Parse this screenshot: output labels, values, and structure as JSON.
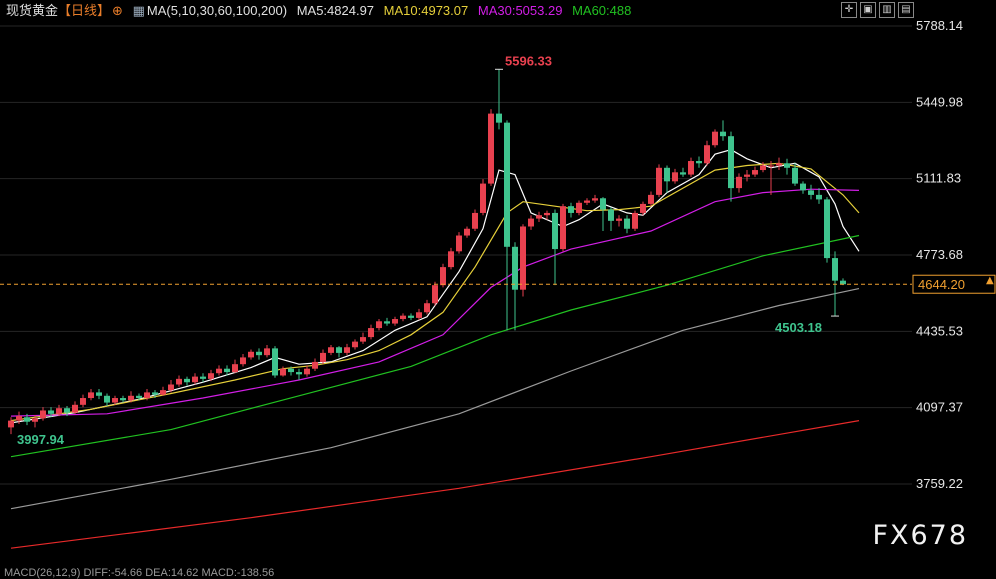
{
  "header": {
    "instrument": "现货黄金",
    "period": "【日线】",
    "period_icon": "circle-plus-icon",
    "ma_icon": "indicator-icon",
    "ma_spec": "MA(5,10,30,60,100,200)",
    "ma5": "MA5:4824.97",
    "ma10": "MA10:4973.07",
    "ma30": "MA30:5053.29",
    "ma60": "MA60:488"
  },
  "toolbar": {
    "icons": [
      "crosshair-icon",
      "fit-icon",
      "chart-toggle-icon",
      "settings-icon"
    ]
  },
  "watermark": "FX678",
  "footer_text": "MACD(26,12,9) DIFF:-54.66 DEA:14.62 MACD:-138.56",
  "colors": {
    "up": "#e8414f",
    "down": "#3fc48e",
    "bg": "#000000",
    "ma5": "#ffffff",
    "ma10": "#e6d03a",
    "ma30": "#d21ee6",
    "ma60": "#21c121",
    "ma100": "#9a9a9a",
    "ma200": "#e82a2a",
    "current": "#f0a030",
    "high_label": "#e8414f",
    "low_label": "#3fc48e"
  },
  "chart_data": {
    "type": "candlestick",
    "ylim": [
      3650,
      5870
    ],
    "y_ticks": [
      "5788.14",
      "5449.98",
      "5111.83",
      "4773.68",
      "4435.53",
      "4097.37",
      "3759.22"
    ],
    "current_price": "4644.20",
    "annotations": {
      "high": "5596.33",
      "low_left": "3997.94",
      "low_right": "4503.18"
    },
    "candles": [
      [
        4010,
        4040,
        3980,
        4055
      ],
      [
        4040,
        4060,
        4025,
        4080
      ],
      [
        4055,
        4035,
        4020,
        4070
      ],
      [
        4035,
        4050,
        4010,
        4065
      ],
      [
        4050,
        4085,
        4040,
        4100
      ],
      [
        4085,
        4070,
        4055,
        4100
      ],
      [
        4070,
        4095,
        4060,
        4110
      ],
      [
        4095,
        4075,
        4060,
        4105
      ],
      [
        4075,
        4110,
        4070,
        4125
      ],
      [
        4110,
        4140,
        4100,
        4155
      ],
      [
        4140,
        4165,
        4130,
        4180
      ],
      [
        4165,
        4150,
        4135,
        4180
      ],
      [
        4150,
        4120,
        4105,
        4160
      ],
      [
        4120,
        4140,
        4110,
        4150
      ],
      [
        4140,
        4130,
        4120,
        4150
      ],
      [
        4130,
        4150,
        4120,
        4170
      ],
      [
        4150,
        4140,
        4130,
        4160
      ],
      [
        4140,
        4165,
        4130,
        4180
      ],
      [
        4165,
        4155,
        4140,
        4175
      ],
      [
        4155,
        4175,
        4150,
        4190
      ],
      [
        4175,
        4200,
        4165,
        4220
      ],
      [
        4200,
        4225,
        4190,
        4240
      ],
      [
        4225,
        4210,
        4195,
        4235
      ],
      [
        4210,
        4235,
        4200,
        4250
      ],
      [
        4235,
        4225,
        4210,
        4250
      ],
      [
        4225,
        4250,
        4215,
        4265
      ],
      [
        4250,
        4270,
        4240,
        4285
      ],
      [
        4270,
        4255,
        4240,
        4285
      ],
      [
        4255,
        4290,
        4250,
        4310
      ],
      [
        4290,
        4320,
        4280,
        4335
      ],
      [
        4320,
        4345,
        4310,
        4355
      ],
      [
        4345,
        4330,
        4310,
        4360
      ],
      [
        4330,
        4360,
        4320,
        4375
      ],
      [
        4360,
        4240,
        4230,
        4370
      ],
      [
        4240,
        4270,
        4235,
        4280
      ],
      [
        4270,
        4255,
        4240,
        4280
      ],
      [
        4255,
        4245,
        4220,
        4270
      ],
      [
        4245,
        4270,
        4235,
        4285
      ],
      [
        4270,
        4300,
        4260,
        4315
      ],
      [
        4300,
        4340,
        4290,
        4355
      ],
      [
        4340,
        4365,
        4330,
        4375
      ],
      [
        4365,
        4340,
        4320,
        4370
      ],
      [
        4340,
        4365,
        4330,
        4380
      ],
      [
        4365,
        4390,
        4355,
        4400
      ],
      [
        4390,
        4410,
        4380,
        4430
      ],
      [
        4410,
        4450,
        4400,
        4465
      ],
      [
        4450,
        4480,
        4440,
        4490
      ],
      [
        4480,
        4470,
        4460,
        4495
      ],
      [
        4470,
        4490,
        4460,
        4500
      ],
      [
        4490,
        4505,
        4480,
        4515
      ],
      [
        4505,
        4495,
        4485,
        4515
      ],
      [
        4495,
        4520,
        4485,
        4535
      ],
      [
        4520,
        4560,
        4510,
        4575
      ],
      [
        4560,
        4640,
        4550,
        4655
      ],
      [
        4640,
        4720,
        4630,
        4735
      ],
      [
        4720,
        4790,
        4710,
        4805
      ],
      [
        4790,
        4860,
        4780,
        4875
      ],
      [
        4860,
        4890,
        4850,
        4900
      ],
      [
        4890,
        4960,
        4880,
        4975
      ],
      [
        4960,
        5090,
        4950,
        5110
      ],
      [
        5090,
        5400,
        5080,
        5420
      ],
      [
        5400,
        5360,
        5330,
        5596
      ],
      [
        5360,
        4810,
        4440,
        5370
      ],
      [
        4810,
        4620,
        4440,
        4830
      ],
      [
        4620,
        4900,
        4590,
        4910
      ],
      [
        4900,
        4935,
        4885,
        4950
      ],
      [
        4935,
        4950,
        4920,
        4965
      ],
      [
        4950,
        4960,
        4930,
        4970
      ],
      [
        4960,
        4800,
        4640,
        4975
      ],
      [
        4800,
        4990,
        4790,
        5000
      ],
      [
        4990,
        4960,
        4940,
        5005
      ],
      [
        4960,
        5005,
        4950,
        5015
      ],
      [
        5005,
        5015,
        4995,
        5025
      ],
      [
        5015,
        5025,
        5005,
        5040
      ],
      [
        5025,
        4975,
        4880,
        5030
      ],
      [
        4975,
        4925,
        4880,
        4985
      ],
      [
        4925,
        4935,
        4900,
        4950
      ],
      [
        4935,
        4890,
        4870,
        4950
      ],
      [
        4890,
        4960,
        4880,
        4970
      ],
      [
        4960,
        5000,
        4950,
        5010
      ],
      [
        5000,
        5040,
        4990,
        5055
      ],
      [
        5040,
        5160,
        5030,
        5175
      ],
      [
        5160,
        5100,
        5050,
        5170
      ],
      [
        5100,
        5140,
        5090,
        5155
      ],
      [
        5140,
        5130,
        5120,
        5160
      ],
      [
        5130,
        5190,
        5120,
        5205
      ],
      [
        5190,
        5180,
        5160,
        5210
      ],
      [
        5180,
        5260,
        5170,
        5280
      ],
      [
        5260,
        5320,
        5250,
        5330
      ],
      [
        5320,
        5300,
        5280,
        5370
      ],
      [
        5300,
        5070,
        5010,
        5320
      ],
      [
        5070,
        5120,
        5050,
        5135
      ],
      [
        5120,
        5130,
        5100,
        5150
      ],
      [
        5130,
        5150,
        5120,
        5165
      ],
      [
        5150,
        5170,
        5140,
        5185
      ],
      [
        5170,
        5170,
        5040,
        5190
      ],
      [
        5170,
        5180,
        5150,
        5205
      ],
      [
        5180,
        5160,
        5130,
        5200
      ],
      [
        5160,
        5090,
        5080,
        5180
      ],
      [
        5090,
        5060,
        5045,
        5100
      ],
      [
        5060,
        5040,
        5020,
        5085
      ],
      [
        5040,
        5020,
        5000,
        5070
      ],
      [
        5020,
        4760,
        4740,
        5030
      ],
      [
        4760,
        4660,
        4503,
        4790
      ],
      [
        4660,
        4644,
        4640,
        4670
      ]
    ],
    "ma_lines": [
      {
        "id": "ma5",
        "values": [
          [
            0,
            4030
          ],
          [
            8,
            4075
          ],
          [
            16,
            4135
          ],
          [
            24,
            4210
          ],
          [
            30,
            4275
          ],
          [
            33,
            4320
          ],
          [
            36,
            4290
          ],
          [
            40,
            4300
          ],
          [
            44,
            4350
          ],
          [
            48,
            4440
          ],
          [
            52,
            4500
          ],
          [
            56,
            4700
          ],
          [
            59,
            4890
          ],
          [
            61,
            5150
          ],
          [
            63,
            5130
          ],
          [
            65,
            4960
          ],
          [
            67,
            4930
          ],
          [
            69,
            4900
          ],
          [
            71,
            4930
          ],
          [
            74,
            5000
          ],
          [
            77,
            4960
          ],
          [
            79,
            4950
          ],
          [
            82,
            5050
          ],
          [
            86,
            5130
          ],
          [
            88,
            5220
          ],
          [
            90,
            5240
          ],
          [
            92,
            5200
          ],
          [
            95,
            5160
          ],
          [
            98,
            5180
          ],
          [
            101,
            5120
          ],
          [
            103,
            5000
          ],
          [
            104,
            4900
          ],
          [
            106,
            4790
          ]
        ]
      },
      {
        "id": "ma10",
        "values": [
          [
            0,
            4040
          ],
          [
            10,
            4090
          ],
          [
            20,
            4160
          ],
          [
            28,
            4220
          ],
          [
            34,
            4270
          ],
          [
            38,
            4285
          ],
          [
            42,
            4310
          ],
          [
            46,
            4350
          ],
          [
            50,
            4420
          ],
          [
            54,
            4520
          ],
          [
            58,
            4720
          ],
          [
            62,
            4960
          ],
          [
            64,
            5010
          ],
          [
            68,
            4990
          ],
          [
            72,
            4970
          ],
          [
            76,
            4975
          ],
          [
            80,
            4990
          ],
          [
            84,
            5070
          ],
          [
            88,
            5150
          ],
          [
            92,
            5170
          ],
          [
            96,
            5180
          ],
          [
            100,
            5155
          ],
          [
            104,
            5040
          ],
          [
            106,
            4960
          ]
        ]
      },
      {
        "id": "ma30",
        "values": [
          [
            0,
            4060
          ],
          [
            12,
            4070
          ],
          [
            24,
            4140
          ],
          [
            36,
            4220
          ],
          [
            46,
            4300
          ],
          [
            54,
            4420
          ],
          [
            60,
            4630
          ],
          [
            64,
            4720
          ],
          [
            70,
            4800
          ],
          [
            80,
            4880
          ],
          [
            88,
            5010
          ],
          [
            94,
            5050
          ],
          [
            100,
            5065
          ],
          [
            106,
            5060
          ]
        ]
      },
      {
        "id": "ma60",
        "values": [
          [
            0,
            3880
          ],
          [
            20,
            4000
          ],
          [
            36,
            4150
          ],
          [
            50,
            4280
          ],
          [
            60,
            4420
          ],
          [
            70,
            4530
          ],
          [
            82,
            4640
          ],
          [
            94,
            4770
          ],
          [
            106,
            4860
          ]
        ]
      },
      {
        "id": "ma100",
        "values": [
          [
            0,
            3650
          ],
          [
            20,
            3780
          ],
          [
            40,
            3920
          ],
          [
            56,
            4070
          ],
          [
            70,
            4260
          ],
          [
            84,
            4440
          ],
          [
            96,
            4550
          ],
          [
            106,
            4625
          ]
        ]
      },
      {
        "id": "ma200",
        "values": [
          [
            0,
            3475
          ],
          [
            30,
            3610
          ],
          [
            56,
            3740
          ],
          [
            80,
            3880
          ],
          [
            106,
            4040
          ]
        ]
      }
    ]
  }
}
